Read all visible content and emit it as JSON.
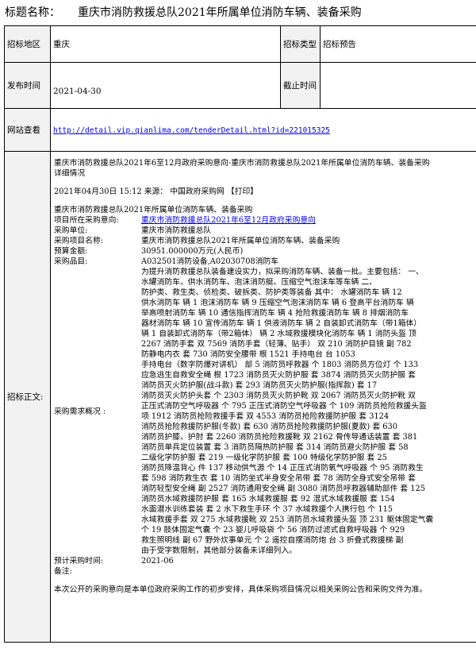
{
  "header": {
    "label": "标题名称：",
    "title": "重庆市消防救援总队2021年所属单位消防车辆、装备采购"
  },
  "fields": {
    "region_label": "招标地区",
    "region_value": "重庆",
    "type_label": "招标类型",
    "type_value": "招标预告",
    "publish_label": "发布时间",
    "publish_value": "2021-04-30",
    "deadline_label": "截止时间",
    "deadline_value": "",
    "website_label": "网站查看",
    "website_url": "http://detail.vip.qianlima.com/tenderDetail.html?id=221015325",
    "body_label": "招标正文:"
  },
  "body": {
    "intro": [
      "重庆市消防救援总队2021年6至12月政府采购意向-重庆市消防救援总队2021年所属单位消防车辆、装备采购",
      "详细情况"
    ],
    "date_line": "2021年04月30日 15:12 来源： 中国政府采购网 【打印】",
    "project_title": "重庆市消防救援总队2021年所属单位消防车辆、装备采购",
    "project_intent_label": "项目所在采购意向:",
    "project_intent_link": "重庆市消防救援总队2021年6至12月政府采购意向",
    "unit_label": "采购单位:",
    "unit_value": "重庆市消防救援总队",
    "project_name_label": "采购项目名称:",
    "project_name_value": "重庆市消防救援总队2021年所属单位消防车辆、装备采购",
    "budget_label": "预算金额:",
    "budget_value": "30951.000000万元(人民币)",
    "items_label": "采购品目:",
    "items_value": "A032501消防设备,A02030708消防车",
    "demand_label": "采购需求概况 :",
    "demand_lines": [
      "为提升消防救援总队装备建设实力，拟采购消防车辆、装备一批。主要包括： 一、",
      "水罐消防车、供水消防车、泡沫消防艇、压缩空气泡沫车等车辆 二、",
      "防护类、救生类、侦检类、破拆类、防护类等装备 其中： 水罐消防车 辆 12",
      "供水消防车 辆 1 泡沫消防车 辆 9 压缩空气泡沫消防车 辆 6 登高平台消防车 辆",
      "举高喷射消防车 辆 10 通信指挥消防车 辆 4 抢险救援消防车 辆 8 排烟消防车",
      "器材消防车 辆 10 宣传消防车 辆 1 供液消防车 辆 2 自装卸式消防车（带1箱体）",
      "辆 1 自装卸式消防车（带2箱体） 辆 2 水域救援模块化消防车 辆 1 消防头盔 顶",
      "2267 消防手套 双 7569 消防手套（轻薄、贴手） 双 210 消防护目镜 副 782",
      "防静电内衣 套 730 消防安全腰带 根 1521 手持电台 台 1053",
      "手持电台（数字防爆对讲机） 部 5 消防员呼救器 个 1803 消防员方位灯 个 133",
      "应急逃生自救安全绳 根 1723 消防员灭火防护服 套 3874 消防员灭火防护服 套",
      "消防员灭火防护服(战斗款) 套 293 消防员灭火防护服(指挥款) 套 17",
      "消防员灭火防护头套 个 2303 消防员灭火防护靴 双 2067 消防员灭火防护靴 双",
      "正压式消防空气呼吸器 个 795 正压式消防空气呼吸器 个 109 消防员抢险救援头盔",
      "项 1912 消防员抢险救援手套 双 4553 消防员抢险救援防护服 套 3124",
      "消防员抢险救援防护服(冬款) 套 630 消防员抢险救援防护服(夏款) 套 630",
      "消防员护膝、护肘 套 2260 消防员抢险救援靴 双 2162 骨传导通话装置 套 381",
      "消防员单兵定位装置 套 3 消防员隔热防护服 套 314 消防员避火防护服 套 58",
      "二级化学防护服 套 219 一级化学防护服 套 100 特级化学防护服 套 25",
      "消防员降温背心 件 137 移动供气源 个 14 正压式消防氧气呼吸器 个 95 消防救生",
      "套 598 消防救生衣 套 10 消防坐式半身安全吊带 套 78 消防全身式安全吊带 套",
      "消防轻型安全绳 副 2527 消防通用安全绳 副 3080 消防员呼救器辅助部件 套 125",
      "消防员水域救援防护服 套 165 水域救援服 套 92 湿式水域救援服 套 154",
      "水面潜水训练套装 套 2 水下救生手环 个 37 水域救援个人携行包 个 115",
      "水域救援手套 双 275 水域救援靴 双 253 消防员水域救援头盔 顶 231 躯体固定气囊",
      "个 19 肢体固定气囊 个 23 婴儿呼吸袋 个 56 消防过滤式自救呼吸器 个 929",
      "救生照明线 副 67 野外炊事单元 个 2 遥控自摆消防炮 台 3 折叠式救援梯 副",
      "由于受字数限制，其他部分装备未详细列入。"
    ],
    "time_label": "预计采购时间:",
    "time_value": "2021-06",
    "remark_label": "备注:",
    "remark_value": "",
    "footer": "本次公开的采购意向是本单位政府采购工作的初步安排，具体采购项目情况以相关采购公告和采购文件为准。"
  }
}
